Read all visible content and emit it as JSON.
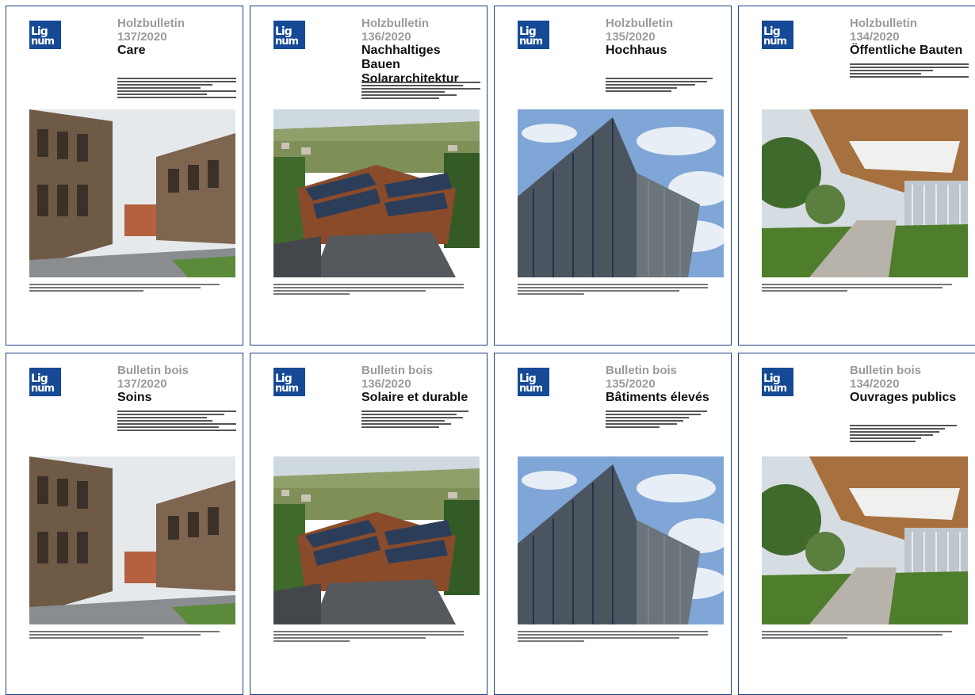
{
  "covers": [
    {
      "logo": "Lignum",
      "series": "Holzbulletin",
      "issue": "137/2020",
      "title": "Care",
      "image": "care-home"
    },
    {
      "logo": "Lignum",
      "series": "Holzbulletin",
      "issue": "136/2020",
      "title": "Nachhaltiges Bauen Solararchitektur",
      "image": "solar-roof"
    },
    {
      "logo": "Lignum",
      "series": "Holzbulletin",
      "issue": "135/2020",
      "title": "Hochhaus",
      "image": "tower"
    },
    {
      "logo": "Lignum",
      "series": "Holzbulletin",
      "issue": "134/2020",
      "title": "Öffentliche Bauten",
      "image": "canopy"
    },
    {
      "logo": "Lignum",
      "series": "Bulletin bois",
      "issue": "137/2020",
      "title": "Soins",
      "image": "care-home"
    },
    {
      "logo": "Lignum",
      "series": "Bulletin bois",
      "issue": "136/2020",
      "title": "Solaire et durable",
      "image": "solar-roof"
    },
    {
      "logo": "Lignum",
      "series": "Bulletin bois",
      "issue": "135/2020",
      "title": "Bâtiments élevés",
      "image": "tower"
    },
    {
      "logo": "Lignum",
      "series": "Bulletin bois",
      "issue": "134/2020",
      "title": "Ouvrages publics",
      "image": "canopy"
    }
  ],
  "colors": {
    "border": "#1f3f86",
    "logo": "#164a96",
    "series": "#9a9a9a"
  }
}
